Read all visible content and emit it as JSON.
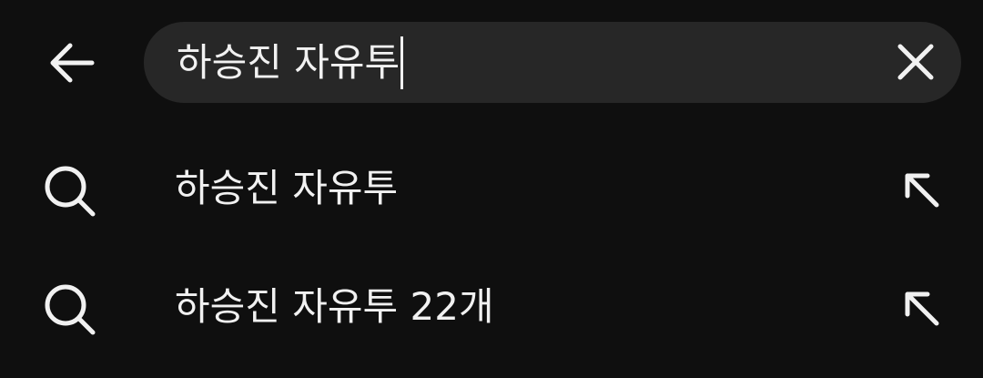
{
  "search": {
    "query": "하승진 자유투"
  },
  "suggestions": [
    {
      "text": "하승진 자유투"
    },
    {
      "text": "하승진 자유투 22개"
    }
  ],
  "icons": {
    "back": "arrow-left-icon",
    "clear": "close-icon",
    "search": "search-icon",
    "fill": "arrow-up-left-icon"
  },
  "colors": {
    "background": "#0f0f0f",
    "search_box": "#272727",
    "text": "#f1f1f1"
  }
}
